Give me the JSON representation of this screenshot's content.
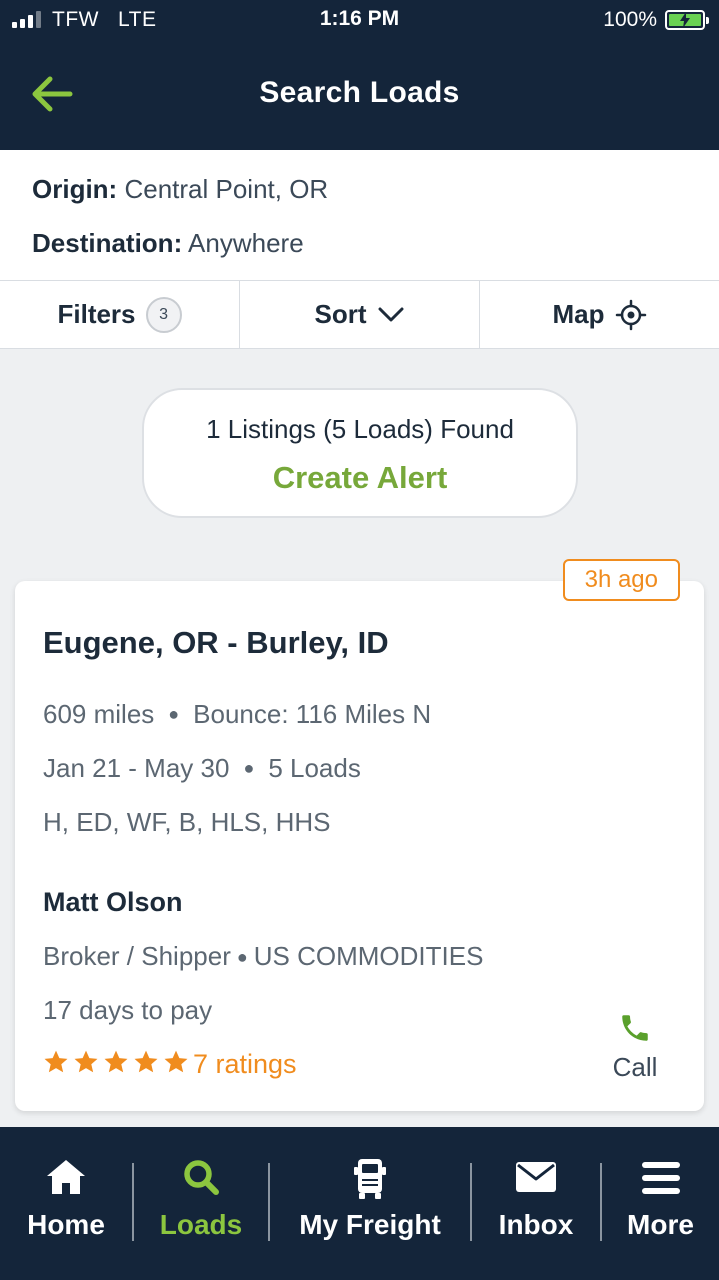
{
  "status_bar": {
    "carrier": "TFW",
    "network": "LTE",
    "time": "1:16 PM",
    "battery": "100%"
  },
  "header": {
    "title": "Search Loads",
    "back_icon": "arrow-left-icon"
  },
  "criteria": {
    "origin_label": "Origin:",
    "origin_value": "Central Point, OR",
    "destination_label": "Destination:",
    "destination_value": "Anywhere"
  },
  "tabs": {
    "filters_label": "Filters",
    "filters_count": "3",
    "sort_label": "Sort",
    "map_label": "Map"
  },
  "summary": {
    "count_text": "1 Listings (5 Loads) Found",
    "alert_label": "Create Alert"
  },
  "listing": {
    "age": "3h ago",
    "route": "Eugene, OR - Burley, ID",
    "miles": "609 miles",
    "bounce": "Bounce: 116 Miles N",
    "dates": "Jan 21 - May 30",
    "loads": "5 Loads",
    "equipment": "H, ED, WF, B, HLS, HHS",
    "contact_name": "Matt Olson",
    "company_type": "Broker / Shipper",
    "company": "US COMMODITIES",
    "pay_terms": "17 days to pay",
    "stars": 5,
    "ratings": "7 ratings",
    "call_label": "Call"
  },
  "bottom_nav": {
    "items": [
      {
        "label": "Home",
        "icon": "home-icon"
      },
      {
        "label": "Loads",
        "icon": "search-icon"
      },
      {
        "label": "My Freight",
        "icon": "truck-icon"
      },
      {
        "label": "Inbox",
        "icon": "envelope-icon"
      },
      {
        "label": "More",
        "icon": "hamburger-menu-icon"
      }
    ],
    "active": "Loads"
  },
  "colors": {
    "header_bg": "#14253a",
    "accent_green": "#8cc63f",
    "alert_green": "#77a83a",
    "orange": "#f08c1e",
    "call_green": "#5aa02c"
  }
}
